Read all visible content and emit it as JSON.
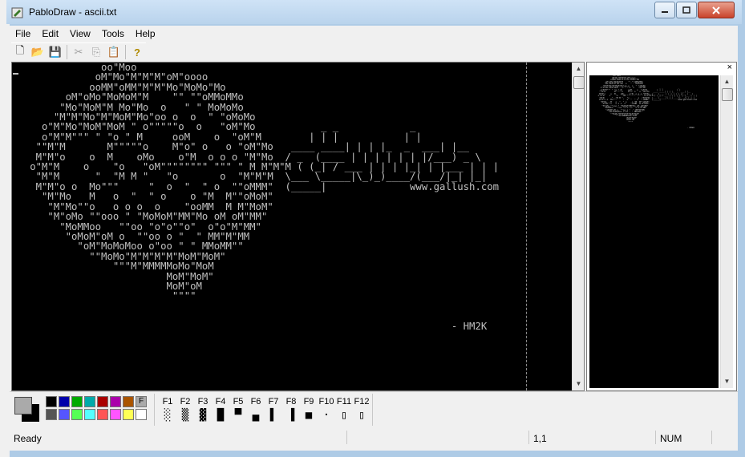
{
  "window": {
    "title": "PabloDraw - ascii.txt"
  },
  "menu": {
    "items": [
      "File",
      "Edit",
      "View",
      "Tools",
      "Help"
    ]
  },
  "toolbar": {
    "buttons": [
      {
        "icon": "new-file-icon",
        "glyph": "🗋"
      },
      {
        "icon": "open-folder-icon",
        "glyph": "📂"
      },
      {
        "icon": "save-icon",
        "glyph": "💾"
      },
      {
        "icon": "cut-icon",
        "glyph": "✂"
      },
      {
        "icon": "copy-icon",
        "glyph": "⎘"
      },
      {
        "icon": "paste-icon",
        "glyph": "📋"
      },
      {
        "icon": "help-icon",
        "glyph": "?"
      }
    ]
  },
  "canvas": {
    "art": "               oo\"Moo\n              oM\"Mo\"M\"M\"M\"oM\"oooo\n             ooMM\"oMM\"M\"M\"Mo\"MoMo\"Mo\n         oM\"oMo\"MoMoM\"M    \"\" \"\"oMMoMMo\n        \"Mo\"MoM\"M Mo\"Mo  o   \" \" MoMoMo\n       \"M\"M\"Mo\"M\"MoM\"Mo\"oo o  o  \" \"oMoMo\n     o\"M\"Mo\"MoM\"MoM \" o\"\"\"\"\"o  o   \"oM\"Mo           _ _            _\n     o\"M\"M\"\"\" \" \"o \" M     ooM    o  \"oM\"M        | | |           | |\n    \"\"M\"M       M\"\"\"\"\"o    M\"o\" o   o \"oM\"Mo   ____ ____| | | |_  _  ___| |__\n    M\"M\"o    o  M    oMo    o\"M  o o o \"M\"Mo  / _  (____ | | | | | | |/___) _ \\\n   o\"M\"M    o    \"o   \"oM\"\"\"\"\"\"\"\" \"\"\" \" M M\"M\"M ( (_| / ___ | | | |_| | |___ | | |\n    \"M\"M      \"  \"M M \"   \"o       o  \"M\"M\"M  \\___ \\_____|\\_)_)____/(___/|_| |_|\n    M\"M\"o o  Mo\"\"\"     \"  o  \"  \" o  \"\"oMMM\"  (_____|              www.gallush.com\n     \"M\"Mo   M   o  \"  \" o    o \"M  M\"\"oMoM\"\n      \"M\"Mo\"\"o   o o o  o    \"ooMM  M M\"MoM\"\n      \"M\"oMo \"\"ooo \" \"MoMoM\"MM\"Mo oM oM\"MM\"\n        \"MoMMoo   \"\"oo \"o\"o\"\"o\"  o\"o\"M\"MM\"\n         \"oMoM\"oM o  \"\"oo o \"  \" MM\"M\"MM\n           \"oM\"MoMoMoo o\"oo \" \" MMoMM\"\"\n             \"\"MoMo\"M\"M\"M\"M\"MoM\"MoM\"\n                 \"\"\"M\"MMMMMoMo\"MoM\n                          MoM\"MoM\"\n                          MoM\"oM\n                           \"\"\"\"\n\n\n                                                                          - HM2K"
  },
  "preview": {
    "close_glyph": "×"
  },
  "palette": {
    "colors": [
      "#000000",
      "#0000aa",
      "#00aa00",
      "#00aaaa",
      "#aa0000",
      "#aa00aa",
      "#aa5500",
      "#aaaaaa",
      "#555555",
      "#5555ff",
      "#55ff55",
      "#55ffff",
      "#ff5555",
      "#ff55ff",
      "#ffff55",
      "#ffffff"
    ],
    "selected_marker": "F",
    "foreground": "#aaaaaa",
    "background": "#000000"
  },
  "fkeys": [
    {
      "label": "F1",
      "glyph": "░"
    },
    {
      "label": "F2",
      "glyph": "▒"
    },
    {
      "label": "F3",
      "glyph": "▓"
    },
    {
      "label": "F4",
      "glyph": "█"
    },
    {
      "label": "F5",
      "glyph": "▀"
    },
    {
      "label": "F6",
      "glyph": "▄"
    },
    {
      "label": "F7",
      "glyph": "▌"
    },
    {
      "label": "F8",
      "glyph": "▐"
    },
    {
      "label": "F9",
      "glyph": "■"
    },
    {
      "label": "F10",
      "glyph": "·"
    },
    {
      "label": "F11",
      "glyph": "▯"
    },
    {
      "label": "F12",
      "glyph": "▯"
    }
  ],
  "status": {
    "message": "Ready",
    "position": "1,1",
    "num": "NUM"
  }
}
